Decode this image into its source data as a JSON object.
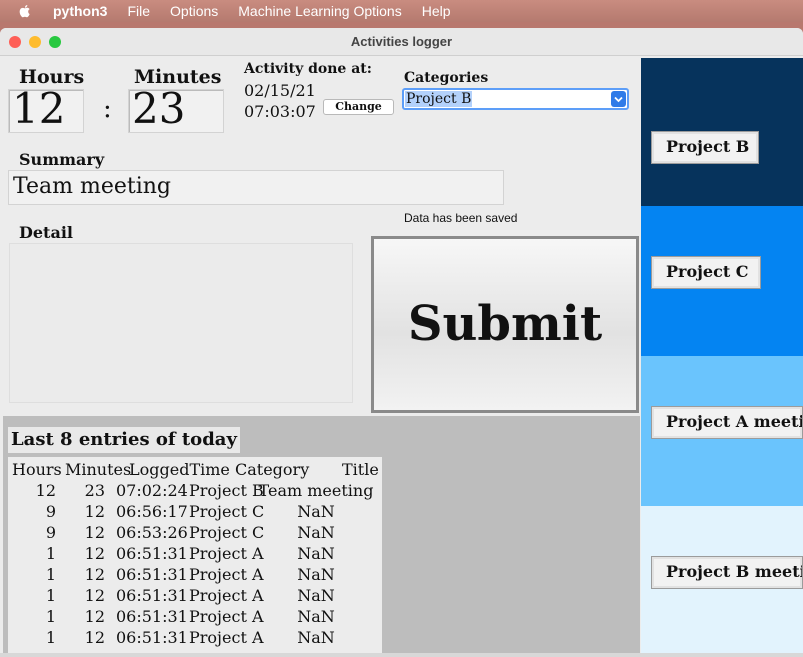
{
  "menubar": {
    "app": "python3",
    "items": [
      "File",
      "Options",
      "Machine Learning Options",
      "Help"
    ]
  },
  "window": {
    "title": "Activities logger"
  },
  "time": {
    "hours_label": "Hours",
    "hours_value": "12",
    "separator": ":",
    "minutes_label": "Minutes",
    "minutes_value": "23"
  },
  "activity": {
    "label": "Activity done at:",
    "date": "02/15/21",
    "time": "07:03:07",
    "change_label": "Change"
  },
  "categories": {
    "label": "Categories",
    "selected": "Project B"
  },
  "summary": {
    "label": "Summary",
    "value": "Team meeting"
  },
  "detail": {
    "label": "Detail",
    "value": ""
  },
  "status": "Data has been saved",
  "submit_label": "Submit",
  "table": {
    "title": "Last 8 entries of today",
    "columns": [
      "Hours",
      "Minutes",
      "LoggedTime",
      "Category",
      "Title"
    ],
    "rows": [
      [
        "12",
        "23",
        "07:02:24",
        "Project B",
        "Team meeting"
      ],
      [
        "9",
        "12",
        "06:56:17",
        "Project C",
        "NaN"
      ],
      [
        "9",
        "12",
        "06:53:26",
        "Project C",
        "NaN"
      ],
      [
        "1",
        "12",
        "06:51:31",
        "Project A",
        "NaN"
      ],
      [
        "1",
        "12",
        "06:51:31",
        "Project A",
        "NaN"
      ],
      [
        "1",
        "12",
        "06:51:31",
        "Project A",
        "NaN"
      ],
      [
        "1",
        "12",
        "06:51:31",
        "Project A",
        "NaN"
      ],
      [
        "1",
        "12",
        "06:51:31",
        "Project A",
        "NaN"
      ]
    ]
  },
  "projects": [
    {
      "label": "Project B",
      "color": "#06335c"
    },
    {
      "label": "Project C",
      "color": "#0484f2"
    },
    {
      "label": "Project A meeting",
      "color": "#6ac4fd"
    },
    {
      "label": "Project B meeting",
      "color": "#e2f3fd"
    }
  ],
  "colors": {
    "traffic_close": "#fe5f57",
    "traffic_min": "#febc2e",
    "traffic_max": "#28c840",
    "accent": "#2f7be8"
  }
}
